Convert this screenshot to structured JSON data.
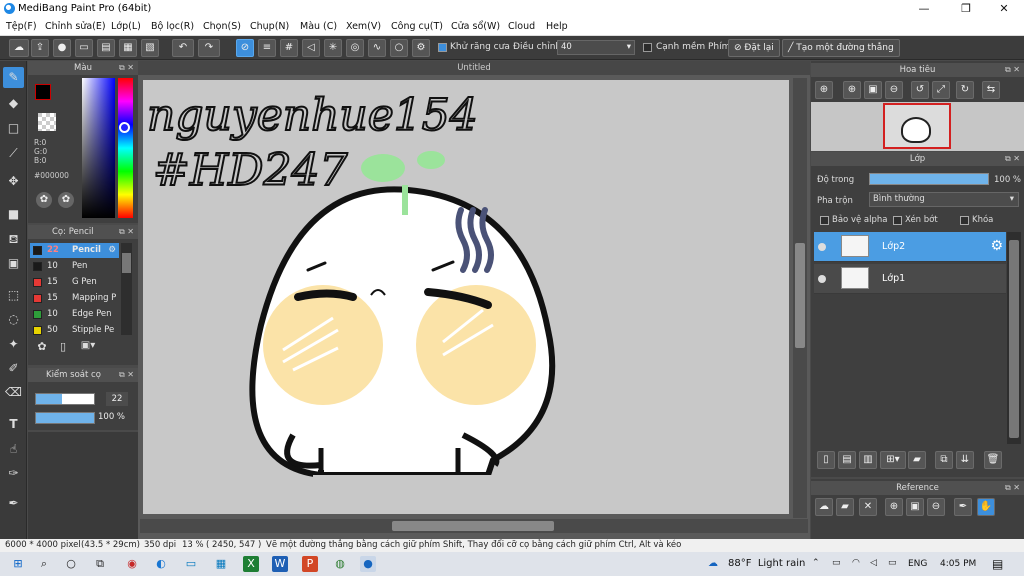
{
  "window": {
    "title": "MediBang Paint Pro (64bit)",
    "minimize": "—",
    "maximize": "❐",
    "close": "✕"
  },
  "menu": [
    "Tệp(F)",
    "Chỉnh sửa(E)",
    "Lớp(L)",
    "Bộ lọc(R)",
    "Chọn(S)",
    "Chụp(N)",
    "Màu (C)",
    "Xem(V)",
    "Công cụ(T)",
    "Cửa sổ(W)",
    "Cloud",
    "Help"
  ],
  "toolbar": {
    "antialias_label": "Khử răng cưa",
    "adjust_label": "Điều chỉnh",
    "adjust_value": "40",
    "soft_edge_label": "Cạnh mềm",
    "key_label": "Phím",
    "reset_label": "Đặt lại",
    "make_line_label": "Tạo một đường thẳng"
  },
  "color_panel": {
    "title": "Màu",
    "r": "R:0",
    "g": "G:0",
    "b": "B:0",
    "hex": "#000000",
    "primary_color": "#000000"
  },
  "brush_panel": {
    "title": "Cọ: Pencil",
    "items": [
      {
        "size": "22",
        "name": "Pencil",
        "color": "#1a1a1a",
        "selected": true
      },
      {
        "size": "10",
        "name": "Pen",
        "color": "#1a1a1a",
        "selected": false
      },
      {
        "size": "15",
        "name": "G Pen",
        "color": "#e53935",
        "selected": false
      },
      {
        "size": "15",
        "name": "Mapping P",
        "color": "#e53935",
        "selected": false
      },
      {
        "size": "10",
        "name": "Edge Pen",
        "color": "#2e9e3a",
        "selected": false
      },
      {
        "size": "50",
        "name": "Stipple Pe",
        "color": "#e8d400",
        "selected": false
      }
    ]
  },
  "brush_control": {
    "title": "Kiểm soát cọ",
    "size": "22",
    "opacity": "100 %",
    "size_fraction": 0.44,
    "opacity_fraction": 1.0
  },
  "document": {
    "tab_title": "Untitled"
  },
  "canvas_text": {
    "line1": "nguyenhue154",
    "line2": "#HD247"
  },
  "navigator": {
    "title": "Hoa tiêu"
  },
  "layers": {
    "title": "Lớp",
    "opacity_label": "Độ trong",
    "opacity_value": "100 %",
    "blend_label": "Pha trộn",
    "blend_value": "Bình thường",
    "protect_alpha": "Bảo vệ alpha",
    "clipping": "Xén bớt",
    "lock": "Khóa",
    "items": [
      {
        "name": "Lớp2",
        "selected": true
      },
      {
        "name": "Lớp1",
        "selected": false
      }
    ]
  },
  "reference": {
    "title": "Reference"
  },
  "status": {
    "size": "6000 * 4000 pixel",
    "cm": "(43.5 * 29cm)",
    "dpi": "350 dpi",
    "zoom": "13 %",
    "coords": "( 2450, 547 )",
    "hint": "Vẽ một đường thẳng bằng cách giữ phím Shift, Thay đổi cỡ cọ bằng cách giữ phím Ctrl, Alt và kéo"
  },
  "taskbar": {
    "weather": "88°F  Light rain",
    "lang": "ENG",
    "time": "4:05 PM"
  },
  "colors": {
    "accent": "#3d8fdc",
    "cheek": "#fbe3a8",
    "sprout": "#9be39b",
    "sweat": "#4a5277"
  }
}
